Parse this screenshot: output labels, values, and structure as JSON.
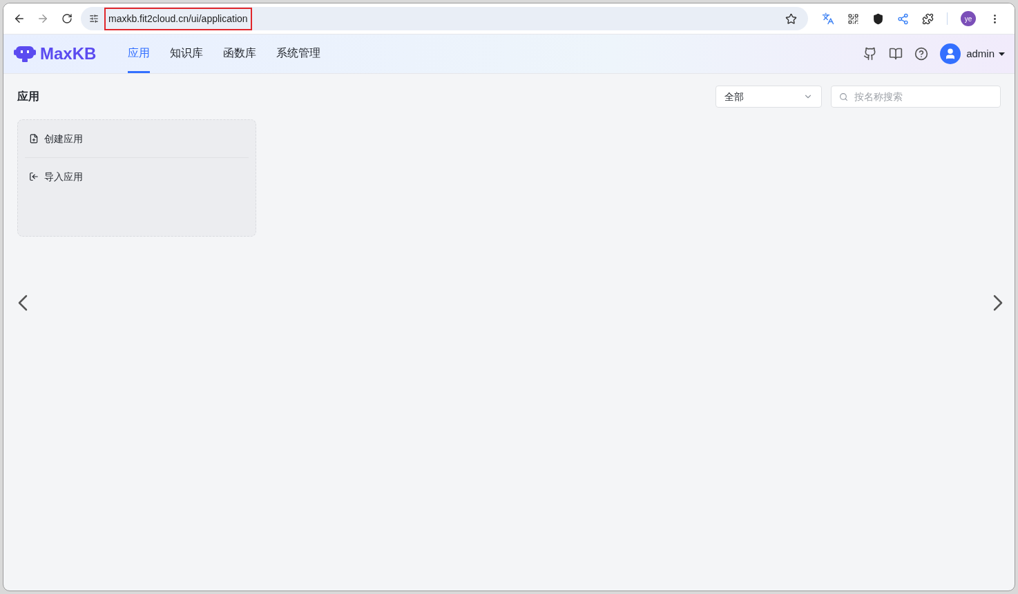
{
  "browser": {
    "url": "maxkb.fit2cloud.cn/ui/application",
    "url_highlighted": true,
    "profile": "ye"
  },
  "app": {
    "logo": "MaxKB",
    "nav": [
      {
        "label": "应用",
        "selected": true
      },
      {
        "label": "知识库",
        "selected": false
      },
      {
        "label": "函数库",
        "selected": false
      },
      {
        "label": "系统管理",
        "selected": false
      }
    ],
    "user": "admin"
  },
  "page": {
    "title": "应用",
    "filter": {
      "value": "全部"
    },
    "search": {
      "placeholder": "按名称搜索"
    },
    "create_card": {
      "items": [
        {
          "kind": "create",
          "label": "创建应用"
        },
        {
          "kind": "import",
          "label": "导入应用"
        }
      ]
    }
  }
}
